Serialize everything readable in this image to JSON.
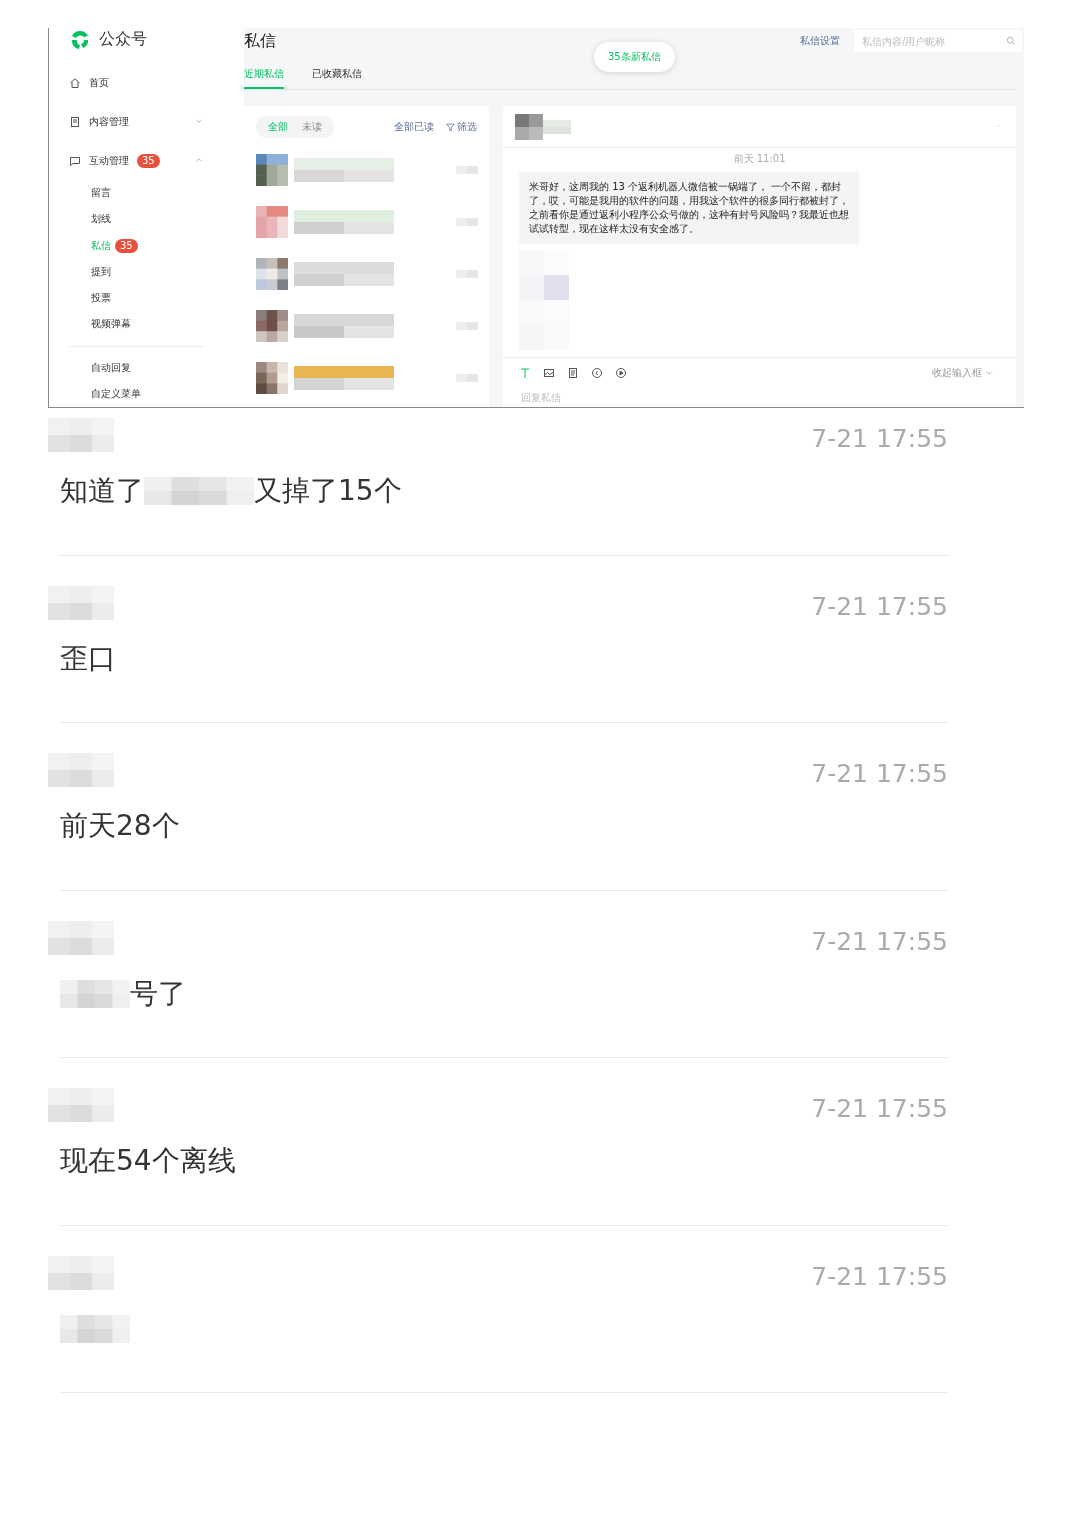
{
  "app": {
    "name": "公众号"
  },
  "sidebar": {
    "items": [
      {
        "label": "首页",
        "kind": "plain"
      },
      {
        "label": "内容管理",
        "kind": "group",
        "expanded": false
      },
      {
        "label": "互动管理",
        "kind": "group",
        "expanded": true,
        "badge": "35",
        "children": [
          {
            "label": "留言",
            "selected": false
          },
          {
            "label": "划线",
            "selected": false
          },
          {
            "label": "私信",
            "selected": true,
            "badge": "35"
          },
          {
            "label": "提到",
            "selected": false
          },
          {
            "label": "投票",
            "selected": false
          },
          {
            "label": "视频弹幕",
            "selected": false
          }
        ]
      }
    ],
    "more_items": [
      {
        "label": "自动回复"
      },
      {
        "label": "自定义菜单"
      }
    ]
  },
  "page": {
    "title": "私信",
    "settings_link": "私信设置",
    "search": {
      "placeholder": "私信内容/用户昵称"
    },
    "toast": "35条新私信",
    "tabs": [
      {
        "label": "近期私信",
        "selected": true
      },
      {
        "label": "已收藏私信",
        "selected": false
      }
    ]
  },
  "list": {
    "filters": [
      {
        "label": "全部",
        "selected": true
      },
      {
        "label": "未读",
        "selected": false
      }
    ],
    "mark_all_read": "全部已读",
    "filter_button": "筛选"
  },
  "chat": {
    "time": "前天 11:01",
    "message": "米哥好，这周我的 13 个返利机器人微信被一锅端了， 一个不留，都封了，哎，可能是我用的软件的问题，用我这个软件的很多同行都被封了，之前看你是通过返利小程序公众号做的，这种有封号风险吗？我最近也想试试转型，现在这样太没有安全感了。",
    "collapse": "收起输入框",
    "reply_placeholder": "回复私信"
  },
  "messages": [
    {
      "time": "7-21 17:55",
      "text": "知道了",
      "text_after": "又掉了15个"
    },
    {
      "time": "7-21 17:55",
      "text": "歪口"
    },
    {
      "time": "7-21 17:55",
      "text": "前天28个"
    },
    {
      "time": "7-21 17:55",
      "text_after": "号了"
    },
    {
      "time": "7-21 17:55",
      "text": "现在54个离线"
    },
    {
      "time": "7-21 17:55"
    }
  ]
}
